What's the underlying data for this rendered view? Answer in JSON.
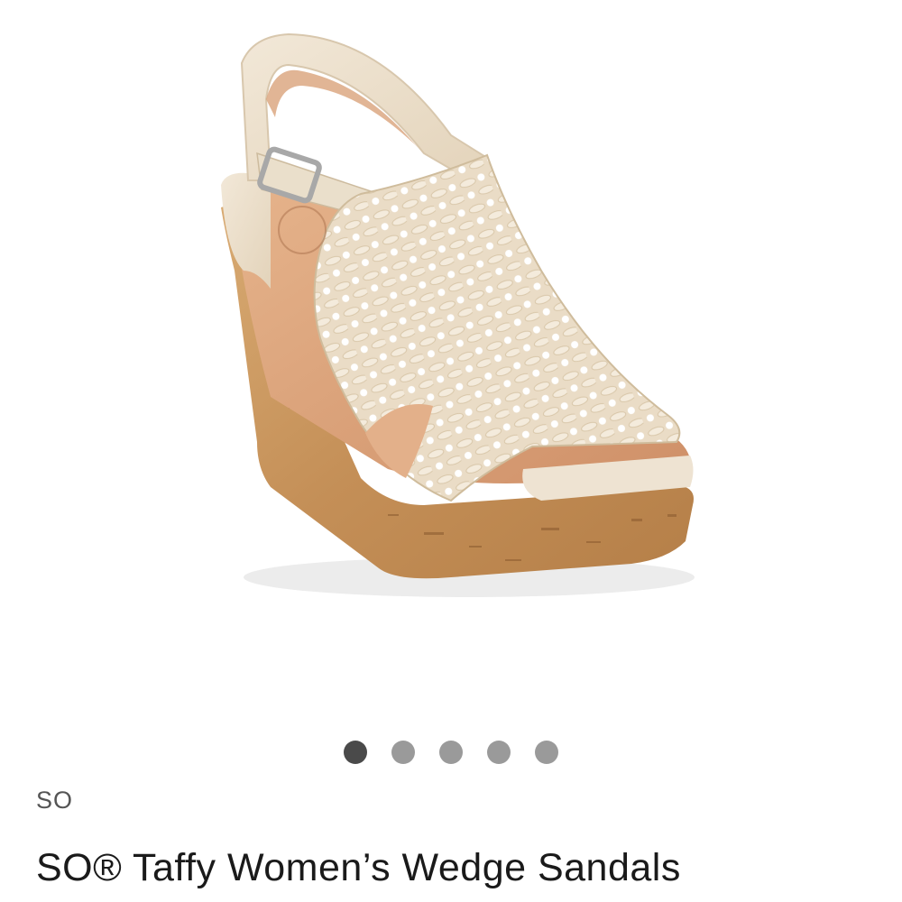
{
  "product": {
    "image_alt": "wedge-sandal-photo",
    "brand": "SO",
    "title": "SO® Taffy Women’s Wedge Sandals"
  },
  "carousel": {
    "count": 5,
    "active_index": 0
  },
  "colors": {
    "dot_active": "#4a4a4a",
    "dot_inactive": "#9a9a9a",
    "cork": "#c8955c",
    "fabric": "#ece0cc",
    "lining": "#d9a27a"
  }
}
